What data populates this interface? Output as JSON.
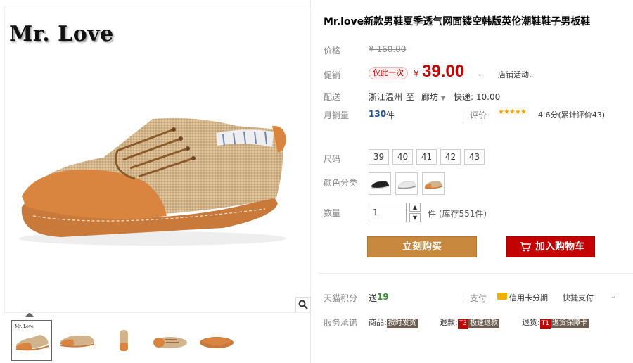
{
  "gallery": {
    "brand": "Mr. Love",
    "thumbnails": [
      "thumb-1",
      "thumb-2",
      "thumb-3",
      "thumb-4",
      "thumb-5"
    ],
    "icons": {
      "zoom": "magnifier-icon"
    }
  },
  "product": {
    "title": "Mr.love新款男鞋夏季透气网面镂空韩版英伦潮鞋鞋子男板鞋"
  },
  "pricing": {
    "price_label": "价格",
    "original_price": "¥ 160.00",
    "promo_label": "促销",
    "promo_tag": "仅此一次",
    "currency": "¥",
    "promo_price": "39.00",
    "store_promo": "店铺活动",
    "accent_color": "#c40000"
  },
  "shipping": {
    "label": "配送",
    "from": "浙江温州",
    "to_word": "至",
    "to": "廊坊",
    "fee": "快递: 10.00"
  },
  "sales": {
    "label": "月销量",
    "value": "130",
    "unit": "件",
    "rating_label": "评价",
    "stars": "★★★★★",
    "rating_score": 4.6,
    "rating_text": "4.6分(累计评价43)"
  },
  "options": {
    "size_label": "尺码",
    "sizes": [
      "39",
      "40",
      "41",
      "42",
      "43"
    ],
    "color_label": "颜色分类",
    "colors": [
      "black",
      "white",
      "orange"
    ],
    "qty_label": "数量",
    "qty_value": "1",
    "qty_unit": "件 (库存551件)"
  },
  "actions": {
    "buy_now": "立刻购买",
    "add_to_cart": "加入购物车"
  },
  "extras": {
    "points_label": "天猫积分",
    "points_prefix": "送",
    "points_value": "19",
    "pay_label": "支付",
    "installment": "信用卡分期",
    "quick_pay": "快捷支付",
    "service_label": "服务承诺",
    "service_goods_prefix": "商品:",
    "service_goods_badge": "按时发货",
    "service_refund_prefix": "退款:",
    "service_refund_code": "T3",
    "service_refund_badge": "极速退款",
    "service_return_prefix": "退货:",
    "service_return_code": "T1",
    "service_return_badge": "退货保障卡"
  }
}
